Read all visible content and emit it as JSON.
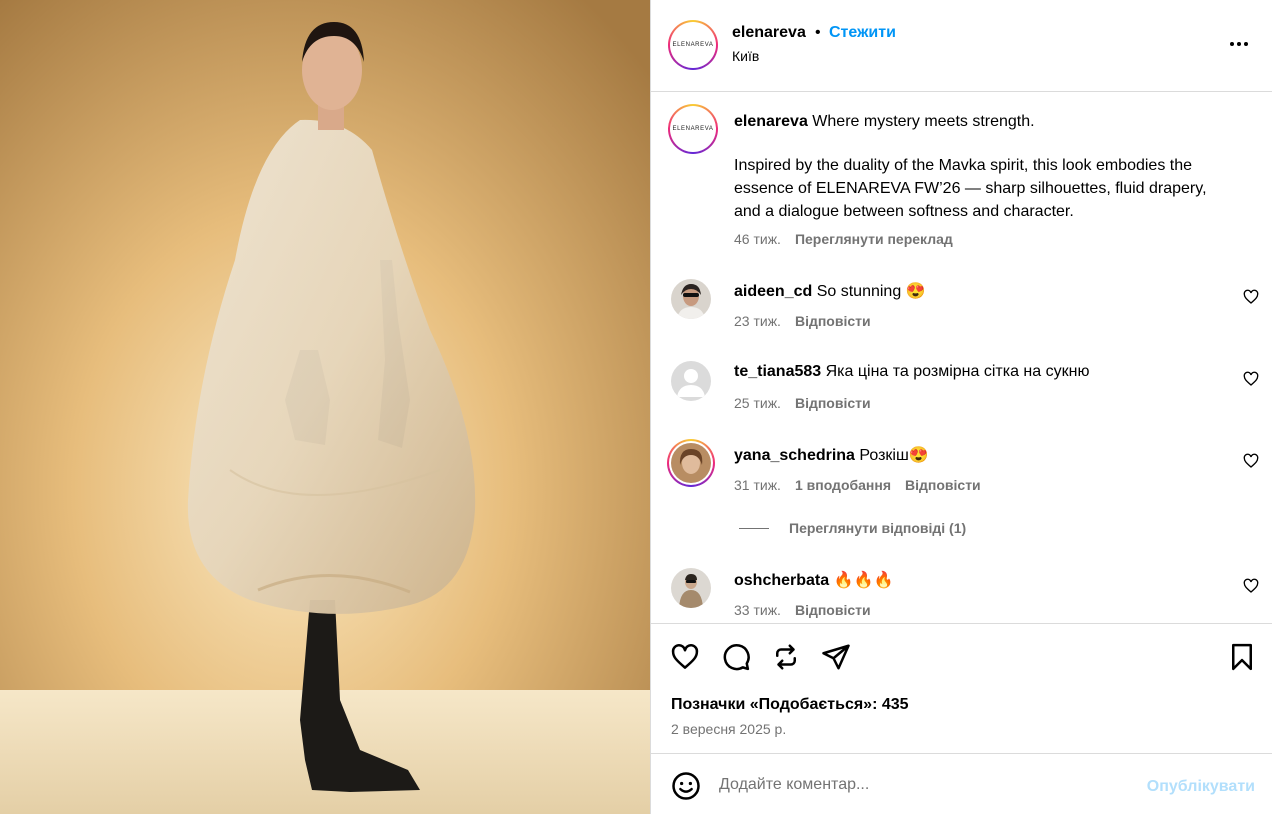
{
  "post": {
    "image_alt": "Model in flowing ivory draped cape dress with black gloves and boots"
  },
  "header": {
    "username": "elenareva",
    "separator": "•",
    "follow_label": "Стежити",
    "location": "Київ",
    "avatar_logo_text": "ELENAREVA"
  },
  "caption": {
    "username": "elenareva",
    "line1": "Where mystery meets strength.",
    "line2": "Inspired by the duality of the Mavka spirit, this look embodies the essence of ELENAREVA FW’26 — sharp silhouettes, fluid drapery, and a dialogue between softness and character.",
    "time": "46 тиж.",
    "translate_label": "Переглянути переклад"
  },
  "comments": [
    {
      "username": "aideen_cd",
      "text": "So stunning 😍",
      "time": "23 тиж.",
      "likes": "",
      "reply_label": "Відповісти"
    },
    {
      "username": "te_tiana583",
      "text": "Яка ціна та розмірна сітка на сукню",
      "time": "25 тиж.",
      "likes": "",
      "reply_label": "Відповісти"
    },
    {
      "username": "yana_schedrina",
      "text": "Розкіш😍",
      "time": "31 тиж.",
      "likes": "1 вподобання",
      "reply_label": "Відповісти"
    },
    {
      "username": "oshcherbata",
      "text": "🔥🔥🔥",
      "time": "33 тиж.",
      "likes": "",
      "reply_label": "Відповісти"
    }
  ],
  "view_replies_label": "Переглянути відповіді (1)",
  "actions": {
    "likes_text": "Позначки «Подобається»: 435",
    "date": "2 вересня 2025 р."
  },
  "add_comment": {
    "placeholder": "Додайте коментар...",
    "publish_label": "Опублікувати"
  },
  "colors": {
    "accent": "#0095f6",
    "publish_disabled": "#b2dffc",
    "muted": "#737373",
    "border": "#dbdbdb"
  }
}
